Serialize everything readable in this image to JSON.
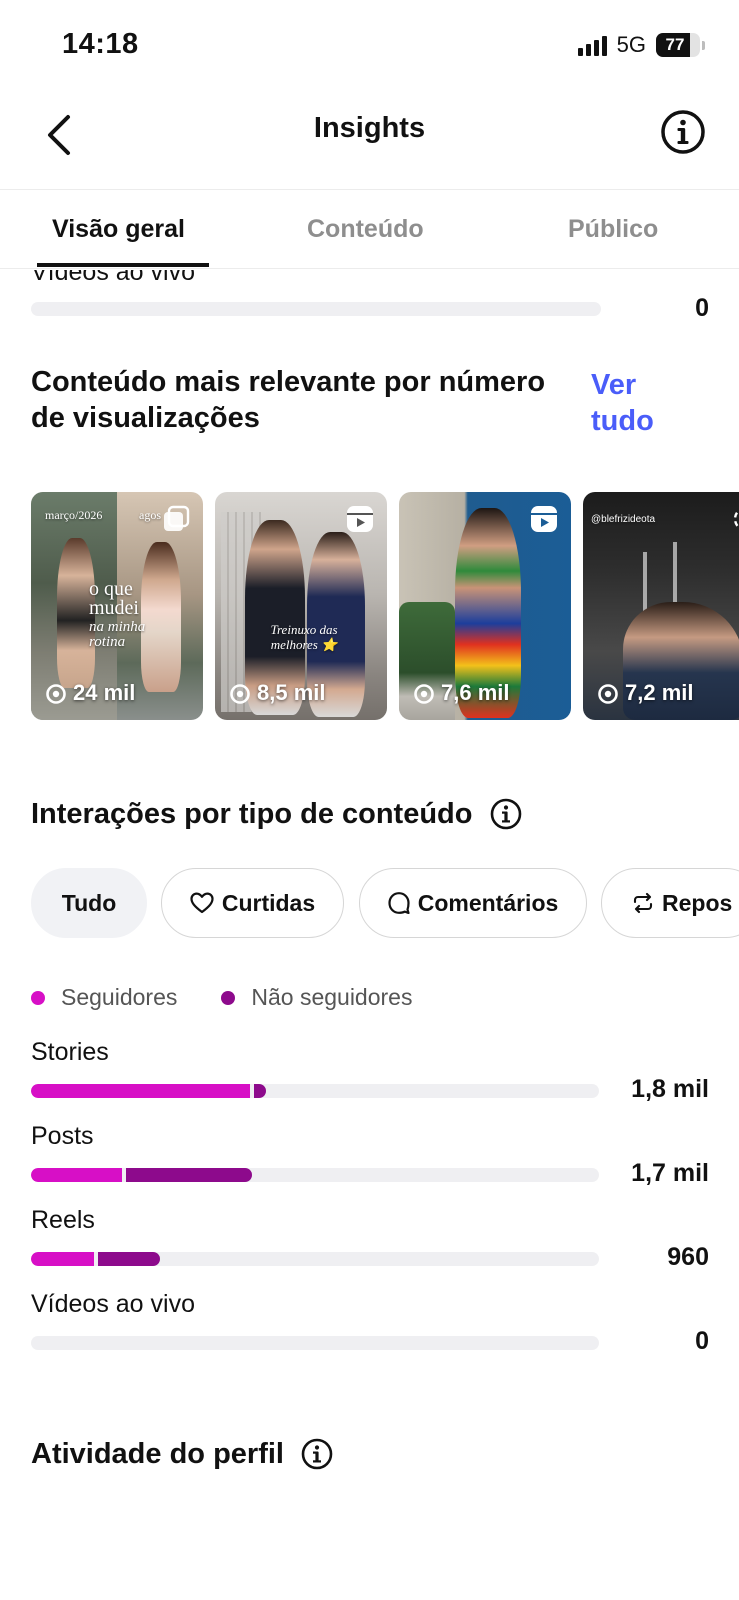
{
  "status_bar": {
    "time": "14:18",
    "network": "5G",
    "battery": "77",
    "battery_level_percent": 77
  },
  "header": {
    "title": "Insights",
    "back_icon": "chevron-left-icon",
    "info_icon": "info-circle-icon"
  },
  "tabs": [
    {
      "label": "Visão geral",
      "active": true
    },
    {
      "label": "Conteúdo",
      "active": false
    },
    {
      "label": "Público",
      "active": false
    }
  ],
  "top_row": {
    "label": "Vídeos ao vivo",
    "value": "0"
  },
  "top_content": {
    "title": "Conteúdo mais relevante por número de visualizações",
    "see_all": "Ver tudo",
    "items": [
      {
        "views": "24 mil",
        "type": "carousel",
        "caption_top_left": "março/2026",
        "caption_top_right": "agos",
        "caption_main": "o que mudei",
        "caption_sub": "na minha rotina"
      },
      {
        "views": "8,5 mil",
        "type": "reel",
        "caption_main": "Treinuxo das melhores ⭐"
      },
      {
        "views": "7,6 mil",
        "type": "reel"
      },
      {
        "views": "7,2 mil",
        "type": "reel",
        "caption_top_left": "@blefrizideota"
      }
    ]
  },
  "interactions": {
    "title": "Interações por tipo de conteúdo",
    "info_icon": "info-circle-icon",
    "chips": [
      {
        "label": "Tudo",
        "icon": "",
        "active": true
      },
      {
        "label": "Curtidas",
        "icon": "heart-icon",
        "active": false
      },
      {
        "label": "Comentários",
        "icon": "comment-icon",
        "active": false
      },
      {
        "label": "Repos",
        "icon": "repost-icon",
        "active": false
      }
    ],
    "legend": [
      {
        "label": "Seguidores",
        "color": "#d70fc6"
      },
      {
        "label": "Não seguidores",
        "color": "#8d0a8c"
      }
    ],
    "rows": [
      {
        "label": "Stories",
        "value": "1,8 mil",
        "followers_fraction": 0.385,
        "nonfollowers_fraction": 0.02
      },
      {
        "label": "Posts",
        "value": "1,7 mil",
        "followers_fraction": 0.16,
        "nonfollowers_fraction": 0.22
      },
      {
        "label": "Reels",
        "value": "960",
        "followers_fraction": 0.11,
        "nonfollowers_fraction": 0.11
      },
      {
        "label": "Vídeos ao vivo",
        "value": "0",
        "followers_fraction": 0,
        "nonfollowers_fraction": 0
      }
    ]
  },
  "profile_activity": {
    "title": "Atividade do perfil",
    "info_icon": "info-circle-icon"
  }
}
